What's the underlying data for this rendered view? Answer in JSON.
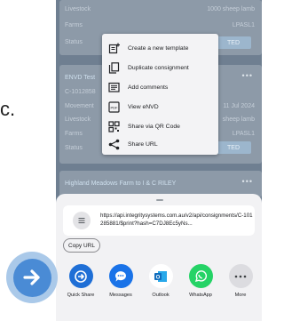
{
  "left_fragment": "c.",
  "background_cards": {
    "card1": {
      "livestock_label": "Livestock",
      "livestock_value": "1000 sheep lamb",
      "farms_label": "Farms",
      "farms_value": "LPASL1",
      "status_label": "Status",
      "status_button": "TED"
    },
    "card2": {
      "title": "ENVD Test",
      "consignment": "C-1012858",
      "movement_label": "Movement",
      "movement_value": "11 Jul 2024",
      "livestock_label": "Livestock",
      "livestock_value": "sheep lamb",
      "farms_label": "Farms",
      "farms_value": "LPASL1",
      "status_label": "Status",
      "status_button": "TED"
    },
    "card3": {
      "title": "Highland Meadows Farm to I & C RILEY"
    }
  },
  "context_menu": {
    "items": [
      {
        "label": "Create a new template",
        "icon": "add-note-icon"
      },
      {
        "label": "Duplicate consignment",
        "icon": "duplicate-icon"
      },
      {
        "label": "Add comments",
        "icon": "comment-icon"
      },
      {
        "label": "View eNVD",
        "icon": "pdf-icon"
      },
      {
        "label": "Share via QR Code",
        "icon": "qr-code-icon"
      },
      {
        "label": "Share URL",
        "icon": "share-icon"
      }
    ]
  },
  "share_sheet": {
    "url": "https://api.integritysystems.com.au/v2/api/consignments/C-101285881/$print?hash=C7DJ8Ec5yNs...",
    "copy_button": "Copy URL",
    "apps": [
      {
        "label": "Quick Share",
        "icon": "quick-share-icon",
        "color": "#1f6fd6"
      },
      {
        "label": "Messages",
        "icon": "messages-icon",
        "color": "#1a73e8"
      },
      {
        "label": "Outlook",
        "icon": "outlook-icon",
        "color": "#0f6cbd"
      },
      {
        "label": "WhatsApp",
        "icon": "whatsapp-icon",
        "color": "#25d366"
      },
      {
        "label": "More",
        "icon": "more-icon",
        "color": "#dcdce0"
      }
    ]
  },
  "overlay_button": {
    "icon": "arrow-right-icon",
    "color": "#4a8bd5"
  }
}
